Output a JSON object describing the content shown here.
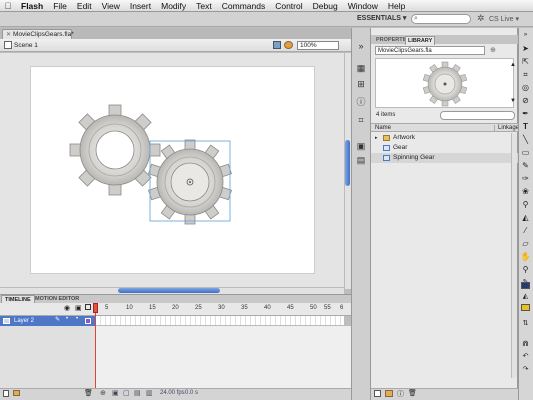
{
  "menubar": {
    "apple": "",
    "items": [
      "Flash",
      "File",
      "Edit",
      "View",
      "Insert",
      "Modify",
      "Text",
      "Commands",
      "Control",
      "Debug",
      "Window",
      "Help"
    ]
  },
  "workspace": {
    "label": "ESSENTIALS ▾",
    "search_placeholder": "",
    "cslive": "CS Live ▾"
  },
  "document": {
    "tab_label": "MovieClipsGears.fla*",
    "scene_label": "Scene 1",
    "zoom": "100%"
  },
  "timeline": {
    "tabs": [
      "TIMELINE",
      "MOTION EDITOR"
    ],
    "layer_name": "Layer 2",
    "frame_numbers": [
      "5",
      "10",
      "15",
      "20",
      "25",
      "30",
      "35",
      "40",
      "45",
      "50",
      "55",
      "6"
    ],
    "fps": "24.00 fps",
    "time": "0.0 s"
  },
  "panel": {
    "tabs": [
      "PROPERTIES",
      "LIBRARY"
    ],
    "library_select": "MovieClipsGears.fla",
    "item_count": "4 items",
    "col_name": "Name",
    "col_linkage": "Linkage",
    "items": [
      {
        "label": "Artwork",
        "icon": "folder-icon"
      },
      {
        "label": "Gear",
        "icon": "movieclip-icon"
      },
      {
        "label": "Spinning Gear",
        "icon": "movieclip-icon"
      }
    ]
  },
  "colors": {
    "accent": "#4f77c7",
    "selection": "#6fa8d8",
    "playhead": "#d43a2a",
    "gear_fill": "#dcdad6",
    "gear_stroke": "#8a8a8a"
  }
}
